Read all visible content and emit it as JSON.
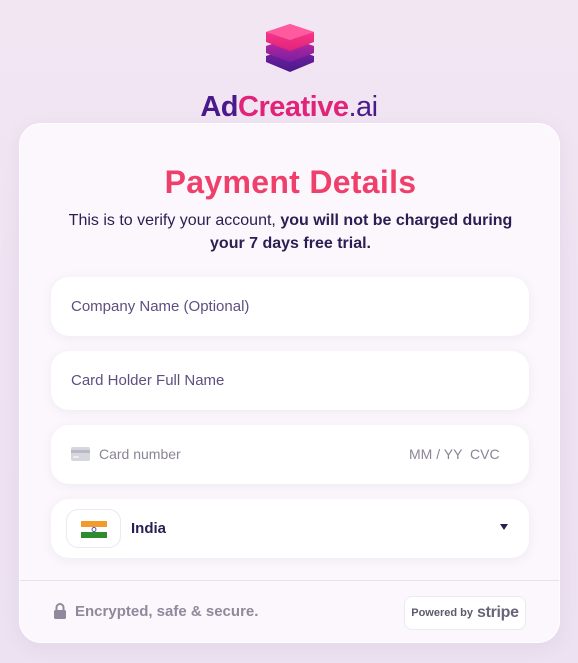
{
  "brand": {
    "logo_part_ad": "Ad",
    "logo_part_creative": "Creative",
    "logo_part_ai": ".ai",
    "colors": {
      "primary_purple": "#4a1a8c",
      "pink": "#e0247a",
      "title": "#ef3f6b"
    }
  },
  "form": {
    "title": "Payment Details",
    "subtitle_plain": "This is to verify your account, ",
    "subtitle_bold": "you will not be charged during your 7 days free trial.",
    "company_placeholder": "Company Name (Optional)",
    "holder_placeholder": "Card Holder Full Name",
    "card_number_placeholder": "Card number",
    "expiry_placeholder": "MM / YY",
    "cvc_placeholder": "CVC",
    "country": {
      "selected": "India",
      "flag_icon": "india-flag-icon"
    }
  },
  "footer": {
    "secure_text": "Encrypted, safe & secure.",
    "powered_by": "Powered by",
    "stripe": "stripe"
  }
}
